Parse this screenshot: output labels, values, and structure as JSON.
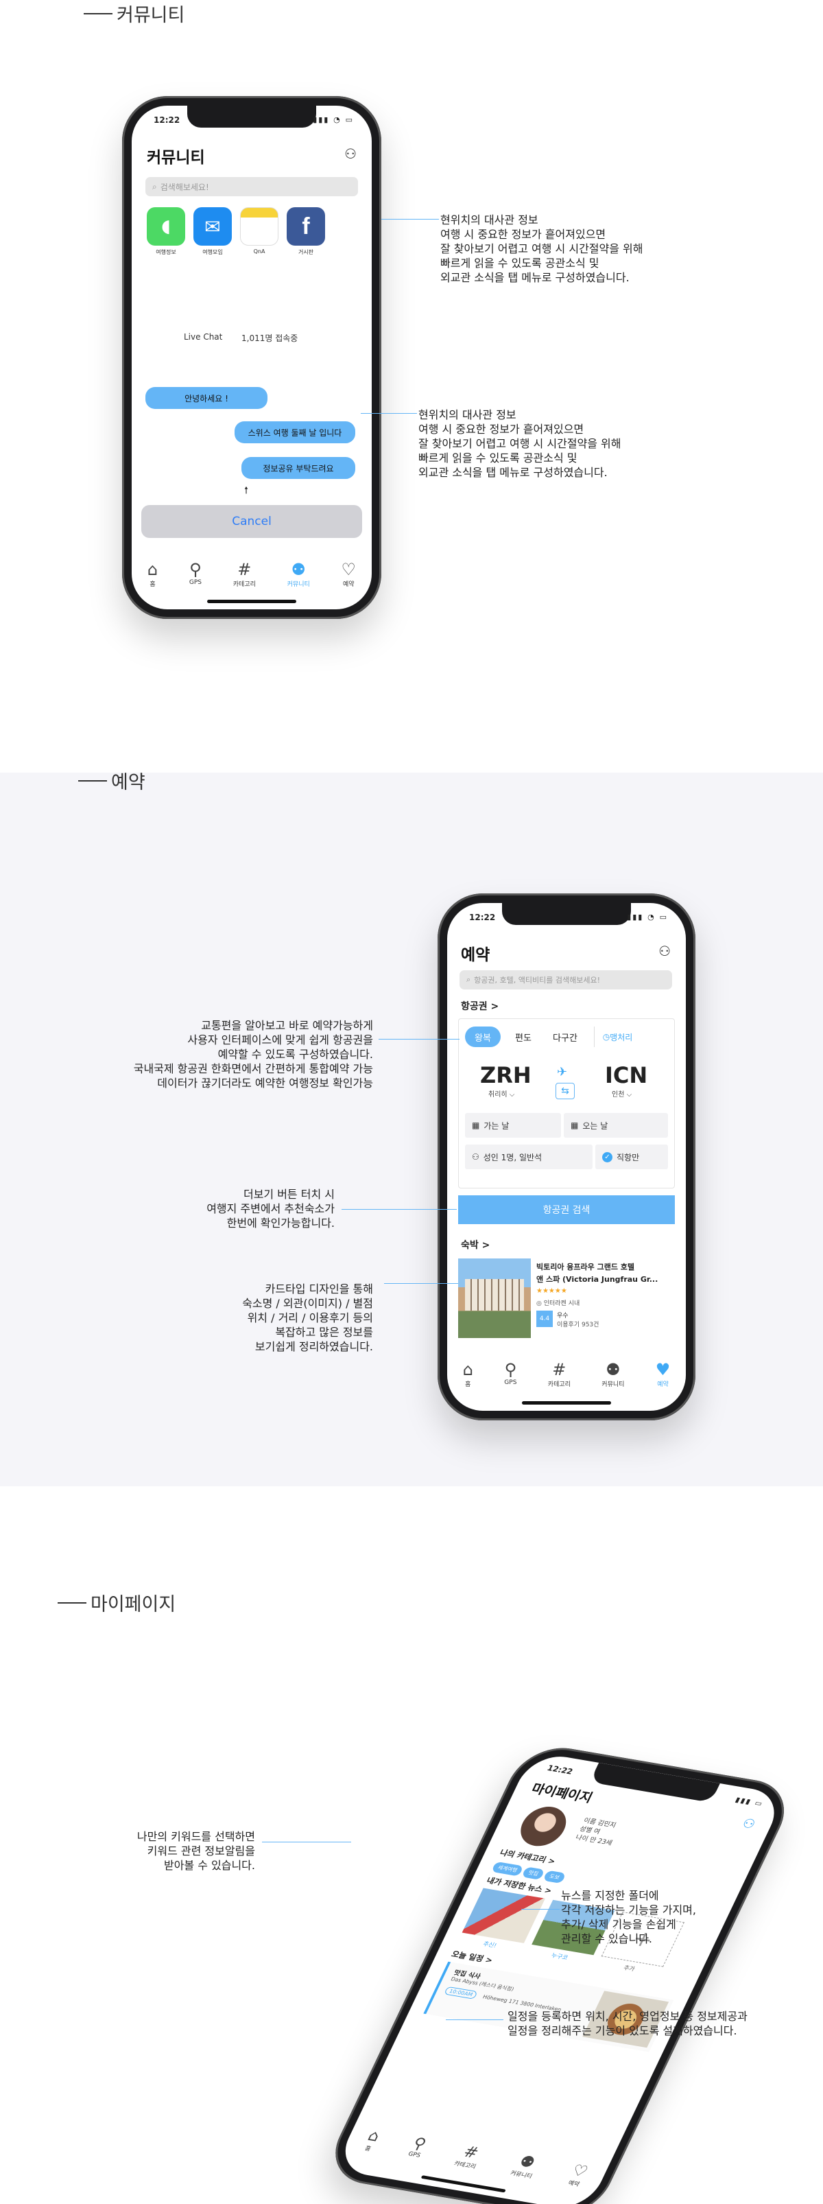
{
  "sections": {
    "community": {
      "title": "커뮤니티"
    },
    "booking": {
      "title": "예약"
    },
    "mypage": {
      "title": "마이페이지"
    }
  },
  "community_phone": {
    "time": "12:22",
    "title": "커뮤니티",
    "search_placeholder": "검색해보세요!",
    "apps": [
      {
        "label": "여행정보",
        "icon": "messages-icon",
        "color": "#4cd964"
      },
      {
        "label": "여행모임",
        "icon": "mail-icon",
        "color": "#1e8cf0"
      },
      {
        "label": "QnA",
        "icon": "notes-icon",
        "color": "#f7d33a"
      },
      {
        "label": "거시판",
        "icon": "facebook-icon",
        "color": "#3b5998"
      }
    ],
    "live_chat": "Live Chat",
    "online_count": "1,011명 접속중",
    "bubble1": "안녕하세요 !",
    "bubble2": "스위스 여행 둘째 날 입니다",
    "bubble3": "정보공유 부탁드려요",
    "cancel": "Cancel"
  },
  "community_notes": {
    "note1": [
      "현위치의 대사관 정보",
      "여행 시 중요한 정보가 흩어져있으면",
      "잘 찾아보기 어렵고 여행 시 시간절약을 위해",
      "빠르게 읽을 수 있도록 공관소식 및",
      "외교관 소식을 탭 메뉴로 구성하였습니다."
    ],
    "note2": [
      "현위치의 대사관 정보",
      "여행 시 중요한 정보가 흩어져있으면",
      "잘 찾아보기 어렵고 여행 시 시간절약을 위해",
      "빠르게 읽을 수 있도록 공관소식 및",
      "외교관 소식을 탭 메뉴로 구성하였습니다."
    ]
  },
  "tabbar": [
    {
      "label": "홈",
      "icon": "home-icon"
    },
    {
      "label": "GPS",
      "icon": "map-pin-icon"
    },
    {
      "label": "카테고리",
      "icon": "hashtag-icon"
    },
    {
      "label": "커뮤니티",
      "icon": "people-icon"
    },
    {
      "label": "예약",
      "icon": "heart-icon"
    }
  ],
  "booking_phone": {
    "time": "12:22",
    "title": "예약",
    "search_placeholder": "항공권, 호텔, 액티비티를 검색해보세요!",
    "flight_header": "항공권 >",
    "trip_types": [
      "왕복",
      "편도",
      "다구간"
    ],
    "mileage": "맹처리",
    "origin_code": "ZRH",
    "origin_city": "취리히 ⌵",
    "dest_code": "ICN",
    "dest_city": "인천 ⌵",
    "depart_label": "가는 날",
    "return_label": "오는 날",
    "passengers": "성인 1명, 일반석",
    "direct": "직항만",
    "search_button": "항공권 검색",
    "hotel_header": "숙박 >",
    "hotel_name1": "빅토리아 융프라우 그랜드 호텔",
    "hotel_name2": "앤 스파 (Victoria Jungfrau Gr...",
    "stars": "★★★★★",
    "distance": "◎ 인터라켄 시내",
    "rating": "4.4",
    "rating_word": "우수",
    "reviews": "이용후기 953건"
  },
  "booking_notes": {
    "note1": [
      "교통편을 알아보고 바로 예약가능하게",
      "사용자 인터페이스에 맞게 쉽게 항공권을",
      "예약할 수 있도록 구성하였습니다.",
      "국내국제 항공권 한화면에서 간편하게 통합예약 가능",
      "데이터가 끊기더라도 예약한 여행정보 확인가능"
    ],
    "note2": [
      "더보기 버튼 터치 시",
      "여행지 주변에서 추천숙소가",
      "한번에 확인가능합니다."
    ],
    "note3": [
      "카드타입 디자인을 통해",
      "숙소명 / 외관(이미지) / 별점",
      "위치 / 거리 / 이용후기 등의",
      "복잡하고 많은 정보를",
      "보기쉽게 정리하였습니다."
    ]
  },
  "mypage_phone": {
    "time": "12:22",
    "title": "마이페이지",
    "profile_name": "이름 김민지",
    "profile_gender": "성별 여",
    "profile_age": "나이 만 23세",
    "keywords_header": "나의 카테고리 >",
    "chips": [
      "세계여행",
      "맛집",
      "도보"
    ],
    "saved_header": "내가 저장한 뉴스 >",
    "folder1": "추신!",
    "folder2": "누구코",
    "add_label": "추가",
    "today_header": "오늘 일정 >",
    "schedule_title": "맛집 식사",
    "schedule_sub": "Das Abyss (레스다 음식점)",
    "schedule_time": "10:00AM",
    "schedule_addr": "Höheweg 171 3800 Interlaken"
  },
  "mypage_notes": {
    "note1": [
      "나만의 키워드를 선택하면",
      "키워드 관련 정보알림을",
      "받아볼 수 있습니다."
    ],
    "note2": [
      "뉴스를 지정한 폴더에",
      "각각 저장하는 기능을 가지며,",
      "추가/ 삭제 기능을 손쉽게",
      "관리할 수 있습니다."
    ],
    "note3": [
      "일정을 등록하면 위치, 시간, 영업정보 등 정보제공과",
      "일정을 정리해주는 기능이 있도록 설계하였습니다."
    ]
  },
  "colors": {
    "accent": "#64b5f6",
    "band": "#f5f5f9"
  }
}
